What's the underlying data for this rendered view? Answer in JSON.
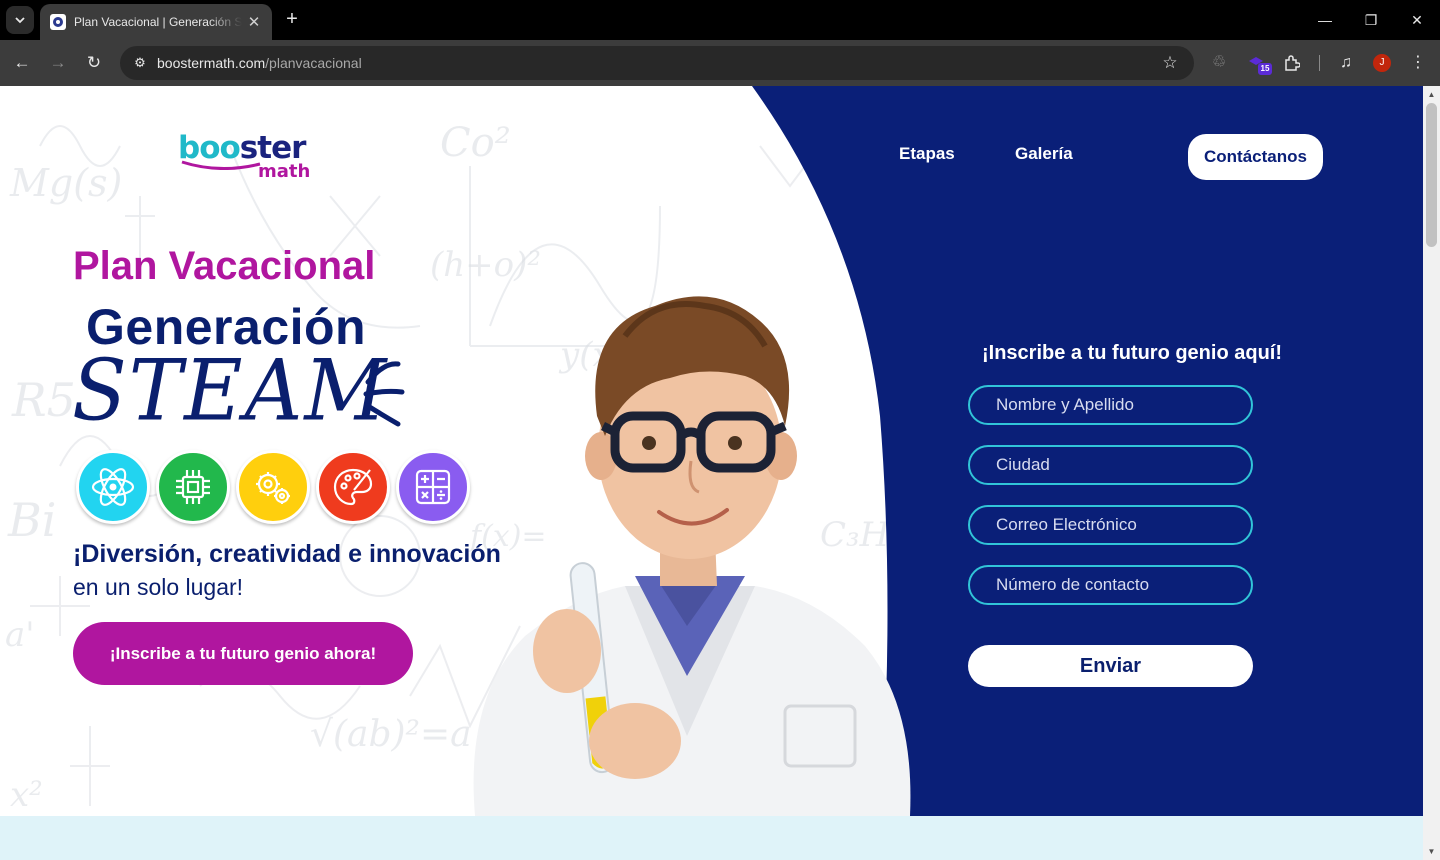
{
  "browser": {
    "tab_title": "Plan Vacacional | Generación STEAM",
    "url_host": "boostermath.com",
    "url_path": "/planvacacional",
    "extension_badge": "15",
    "profile_initial": "J"
  },
  "header": {
    "logo_top_a": "boo",
    "logo_top_b": "ster",
    "logo_bottom": "math",
    "nav": [
      "Etapas",
      "Galería"
    ],
    "contact_label": "Contáctanos"
  },
  "hero": {
    "eyebrow": "Plan Vacacional",
    "title": "Generación",
    "title_script": "STEAM",
    "icons": [
      "atom-icon",
      "chip-icon",
      "gears-icon",
      "palette-icon",
      "calculator-icon"
    ],
    "tagline": "¡Diversión, creatividad e innovación",
    "subline": "en un solo lugar!",
    "cta_label": "¡Inscribe a tu futuro genio ahora!"
  },
  "form": {
    "title": "¡Inscribe a tu futuro genio aquí!",
    "fields": [
      {
        "placeholder": "Nombre y Apellido"
      },
      {
        "placeholder": "Ciudad"
      },
      {
        "placeholder": "Correo Electrónico"
      },
      {
        "placeholder": "Número de contacto"
      }
    ],
    "submit_label": "Enviar"
  },
  "colors": {
    "navy": "#0a1f78",
    "magenta": "#b0169f",
    "cyan": "#31c4d8",
    "band": "#dff3f9"
  }
}
